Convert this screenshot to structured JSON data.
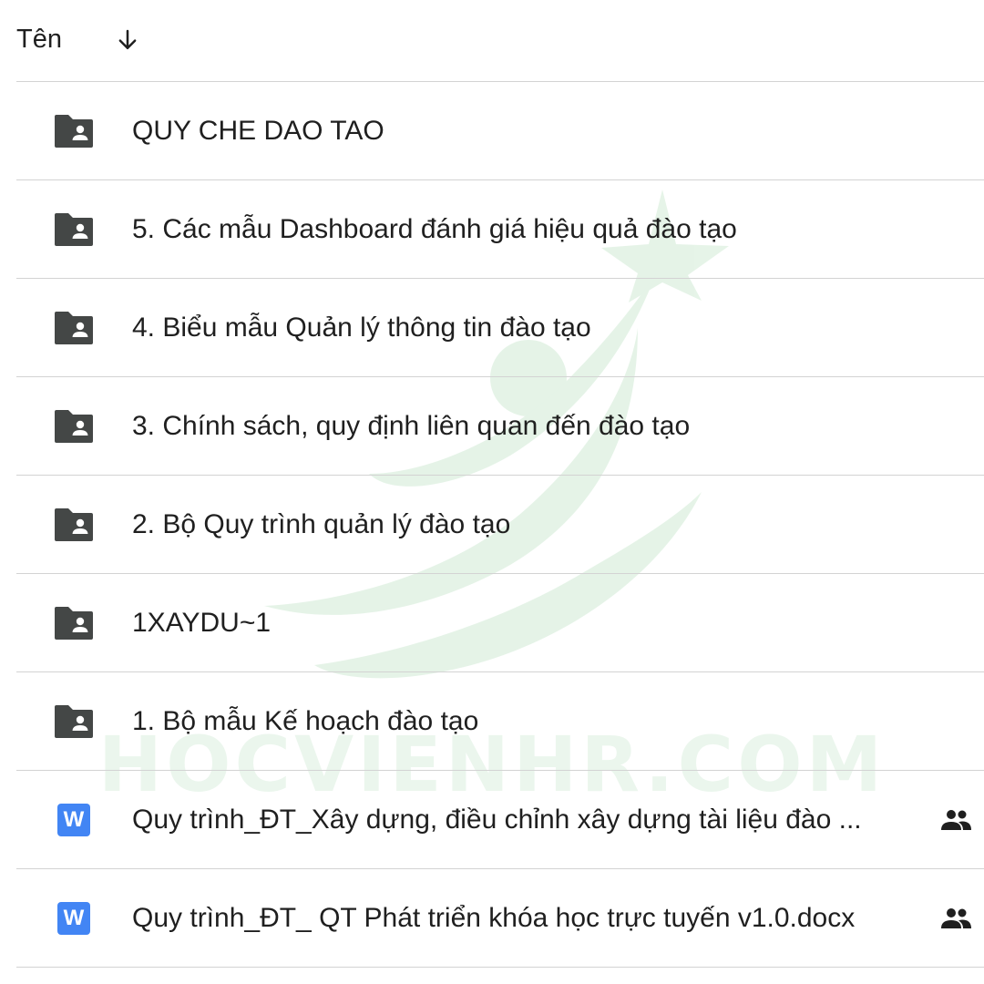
{
  "header": {
    "column_label": "Tên",
    "sort_icon": "arrow-down-icon"
  },
  "watermark": {
    "text": "HOCVIENHR.COM",
    "color": "#3caa50"
  },
  "colors": {
    "folder_icon": "#444746",
    "word_icon": "#4285f4",
    "divider": "#d3d3d3",
    "text": "#1f1f1f"
  },
  "items": [
    {
      "type": "shared-folder",
      "icon": "shared-folder-icon",
      "name": "QUY CHE DAO TAO",
      "shared": false
    },
    {
      "type": "shared-folder",
      "icon": "shared-folder-icon",
      "name": "5. Các mẫu Dashboard đánh giá hiệu quả đào tạo",
      "shared": false
    },
    {
      "type": "shared-folder",
      "icon": "shared-folder-icon",
      "name": "4. Biểu mẫu Quản lý thông tin đào tạo",
      "shared": false
    },
    {
      "type": "shared-folder",
      "icon": "shared-folder-icon",
      "name": "3. Chính sách, quy định liên quan đến đào tạo",
      "shared": false
    },
    {
      "type": "shared-folder",
      "icon": "shared-folder-icon",
      "name": "2. Bộ Quy trình quản lý đào tạo",
      "shared": false
    },
    {
      "type": "shared-folder",
      "icon": "shared-folder-icon",
      "name": "1XAYDU~1",
      "shared": false
    },
    {
      "type": "shared-folder",
      "icon": "shared-folder-icon",
      "name": "1. Bộ mẫu Kế hoạch đào tạo",
      "shared": false
    },
    {
      "type": "word-doc",
      "icon": "word-doc-icon",
      "icon_letter": "W",
      "name": "Quy trình_ĐT_Xây dựng, điều chỉnh xây dựng tài liệu đào ...",
      "shared": true,
      "shared_icon": "people-shared-icon"
    },
    {
      "type": "word-doc",
      "icon": "word-doc-icon",
      "icon_letter": "W",
      "name": "Quy trình_ĐT_ QT Phát triển khóa học trực tuyến v1.0.docx",
      "shared": true,
      "shared_icon": "people-shared-icon"
    }
  ]
}
